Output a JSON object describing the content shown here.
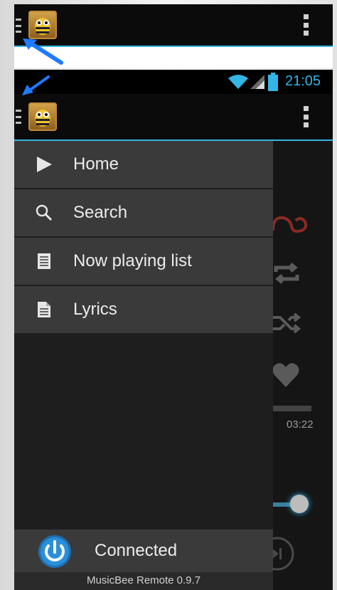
{
  "drawer": {
    "items": [
      {
        "label": "Home",
        "icon": "play-icon"
      },
      {
        "label": "Search",
        "icon": "search-icon"
      },
      {
        "label": "Now playing list",
        "icon": "list-icon"
      },
      {
        "label": "Lyrics",
        "icon": "document-icon"
      }
    ],
    "connection": {
      "status": "Connected",
      "icon": "power-icon"
    },
    "version": "MusicBee Remote 0.9.7"
  },
  "status_bar": {
    "time": "21:05",
    "icons": [
      "wifi-icon",
      "signal-icon",
      "battery-icon"
    ]
  },
  "player_background": {
    "elapsed_time": "03:22"
  },
  "colors": {
    "accent": "#33b5e5",
    "annotation_arrow": "#1e7bff",
    "lastfm_red": "#c0352b"
  }
}
